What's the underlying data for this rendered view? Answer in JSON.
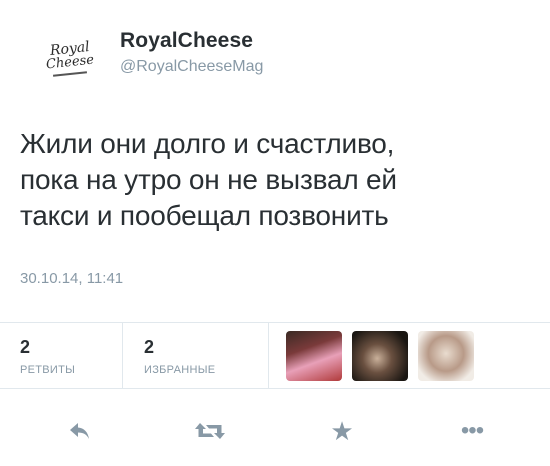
{
  "tweet": {
    "avatar_text": {
      "line1": "Royal",
      "line2": "Cheese"
    },
    "display_name": "RoyalCheese",
    "handle": "@RoyalCheeseMag",
    "text_lines": [
      "Жили они долго и счастливо,",
      "пока на утро он не вызвал ей",
      "такси и пообещал позвонить"
    ],
    "timestamp": "30.10.14, 11:41"
  },
  "stats": {
    "retweets": {
      "count": "2",
      "label": "РЕТВИТЫ"
    },
    "favorites": {
      "count": "2",
      "label": "ИЗБРАННЫЕ"
    }
  },
  "favoriters": [
    "avatar-1",
    "avatar-2",
    "avatar-3"
  ],
  "actions": {
    "reply_icon": "reply-icon",
    "retweet_icon": "retweet-icon",
    "favorite_icon": "star-icon",
    "more_icon": "more-icon",
    "favorite_glyph": "★",
    "more_glyph": "•••"
  },
  "colors": {
    "text": "#292f33",
    "muted": "#8899a6",
    "border": "#e1e8ed"
  }
}
